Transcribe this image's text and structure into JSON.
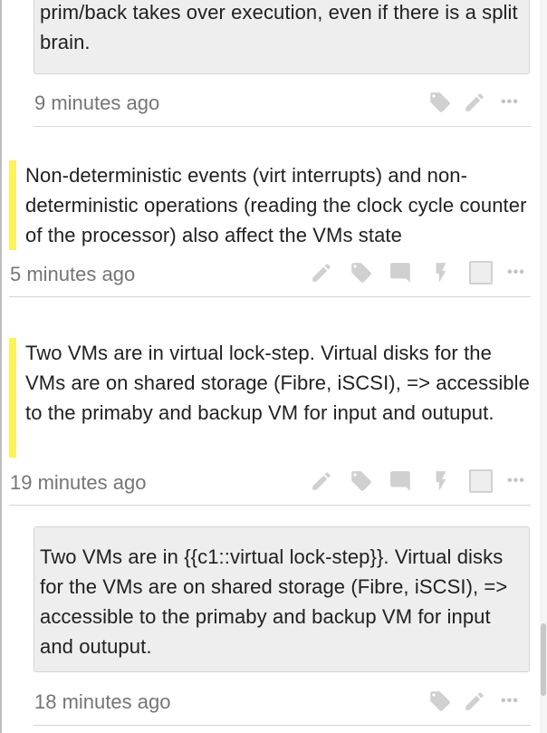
{
  "cards": [
    {
      "text": "prim/back takes over execution, even if there is a split brain.",
      "time": "9 minutes ago"
    },
    {
      "text": "Non-deterministic events (virt interrupts) and non-deterministic operations (reading the clock cycle counter of the processor) also affect the VMs state",
      "time": "5 minutes ago"
    },
    {
      "text": "Two VMs are in virtual lock-step. Virtual disks for the VMs are on shared storage (Fibre, iSCSI), => accessible to the primaby and backup VM for input and outuput.",
      "time": "19 minutes ago"
    },
    {
      "text": "Two VMs are in {{c1::virtual lock-step}}. Virtual disks for the VMs are on shared storage (Fibre, iSCSI), => accessible to the primaby and backup VM for input and outuput.",
      "time": "18 minutes ago"
    }
  ],
  "icons": {
    "tag": "tag-icon",
    "edit": "pencil-icon",
    "comment": "comment-icon",
    "flash": "lightning-icon",
    "select": "checkbox-icon",
    "more": "more-dots-icon",
    "more_glyph": "•••"
  },
  "colors": {
    "highlight": "#fff34d",
    "card_bg": "#eeeeee",
    "icon": "#d0d0d0",
    "time": "#757575"
  }
}
